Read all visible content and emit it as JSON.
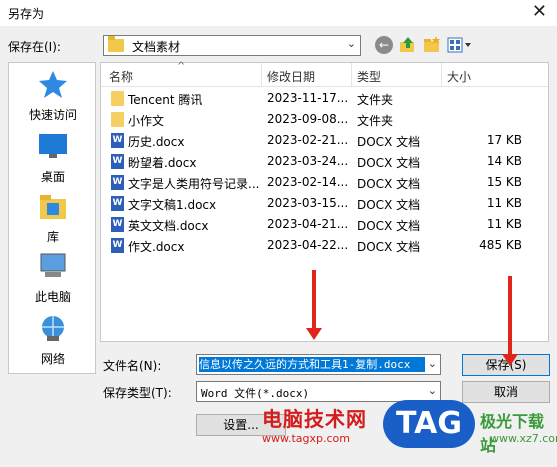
{
  "window": {
    "title": "另存为"
  },
  "toolbar": {
    "save_in_label": "保存在(I):",
    "location": "文档素材"
  },
  "places": [
    {
      "label": "快速访问",
      "icon": "star-icon"
    },
    {
      "label": "桌面",
      "icon": "desktop-icon"
    },
    {
      "label": "库",
      "icon": "library-icon"
    },
    {
      "label": "此电脑",
      "icon": "computer-icon"
    },
    {
      "label": "网络",
      "icon": "network-icon"
    }
  ],
  "columns": {
    "name": "名称",
    "date": "修改日期",
    "type": "类型",
    "size": "大小"
  },
  "files": [
    {
      "name": "Tencent 腾讯",
      "date": "2023-11-17...",
      "type": "文件夹",
      "size": "",
      "kind": "folder"
    },
    {
      "name": "小作文",
      "date": "2023-09-08...",
      "type": "文件夹",
      "size": "",
      "kind": "folder"
    },
    {
      "name": "历史.docx",
      "date": "2023-02-21...",
      "type": "DOCX 文档",
      "size": "17 KB",
      "kind": "doc"
    },
    {
      "name": "盼望着.docx",
      "date": "2023-03-24...",
      "type": "DOCX 文档",
      "size": "14 KB",
      "kind": "doc"
    },
    {
      "name": "文字是人类用符号记录...",
      "date": "2023-02-14...",
      "type": "DOCX 文档",
      "size": "15 KB",
      "kind": "doc"
    },
    {
      "name": "文字文稿1.docx",
      "date": "2023-03-15...",
      "type": "DOCX 文档",
      "size": "11 KB",
      "kind": "doc"
    },
    {
      "name": "英文文档.docx",
      "date": "2023-04-21...",
      "type": "DOCX 文档",
      "size": "11 KB",
      "kind": "doc"
    },
    {
      "name": "作文.docx",
      "date": "2023-04-22...",
      "type": "DOCX 文档",
      "size": "485 KB",
      "kind": "doc"
    }
  ],
  "form": {
    "filename_label": "文件名(N):",
    "filename_value": "信息以传之久远的方式和工具1-复制.docx",
    "filetype_label": "保存类型(T):",
    "filetype_value": "Word 文件(*.docx)"
  },
  "buttons": {
    "save": "保存(S)",
    "cancel": "取消",
    "settings": "设置..."
  },
  "watermark": {
    "site_name": "电脑技术网",
    "site_url": "www.tagxp.com",
    "badge": "TAG",
    "download": "极光下载站",
    "download_url": "www.xz7.com"
  },
  "colors": {
    "accent": "#0078d7",
    "arrow": "#e0251b"
  }
}
